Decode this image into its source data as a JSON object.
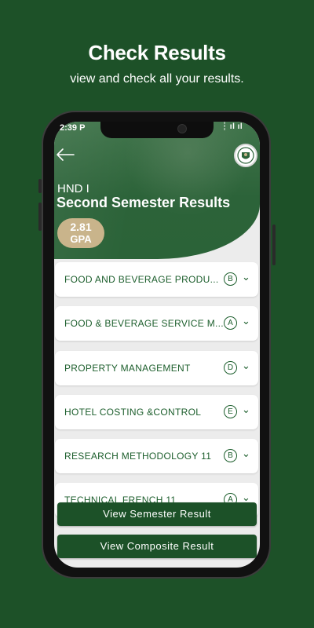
{
  "promo": {
    "title": "Check Results",
    "subtitle": "view and check all your results."
  },
  "status_bar": {
    "left": "2:39  P",
    "right": "┆ ıl ıl"
  },
  "header": {
    "level": "HND I",
    "title": "Second Semester Results",
    "gpa_value": "2.81",
    "gpa_label": "GPA"
  },
  "courses": [
    {
      "name": "FOOD AND BEVERAGE PRODU...",
      "grade": "B"
    },
    {
      "name": "FOOD & BEVERAGE SERVICE M...",
      "grade": "A"
    },
    {
      "name": "PROPERTY MANAGEMENT",
      "grade": "D"
    },
    {
      "name": "HOTEL COSTING &CONTROL",
      "grade": "E"
    },
    {
      "name": "RESEARCH METHODOLOGY 11",
      "grade": "B"
    },
    {
      "name": "TECHNICAL FRENCH 11",
      "grade": "A"
    }
  ],
  "buttons": {
    "semester": "View Semester Result",
    "composite": "View Composite Result"
  },
  "colors": {
    "background": "#1d5128",
    "accent": "#1c5e2c",
    "gpa_badge": "#c9b48b"
  },
  "icons": {
    "back": "arrow-left-icon",
    "chevron": "chevron-down-icon",
    "logo": "school-crest-icon"
  }
}
